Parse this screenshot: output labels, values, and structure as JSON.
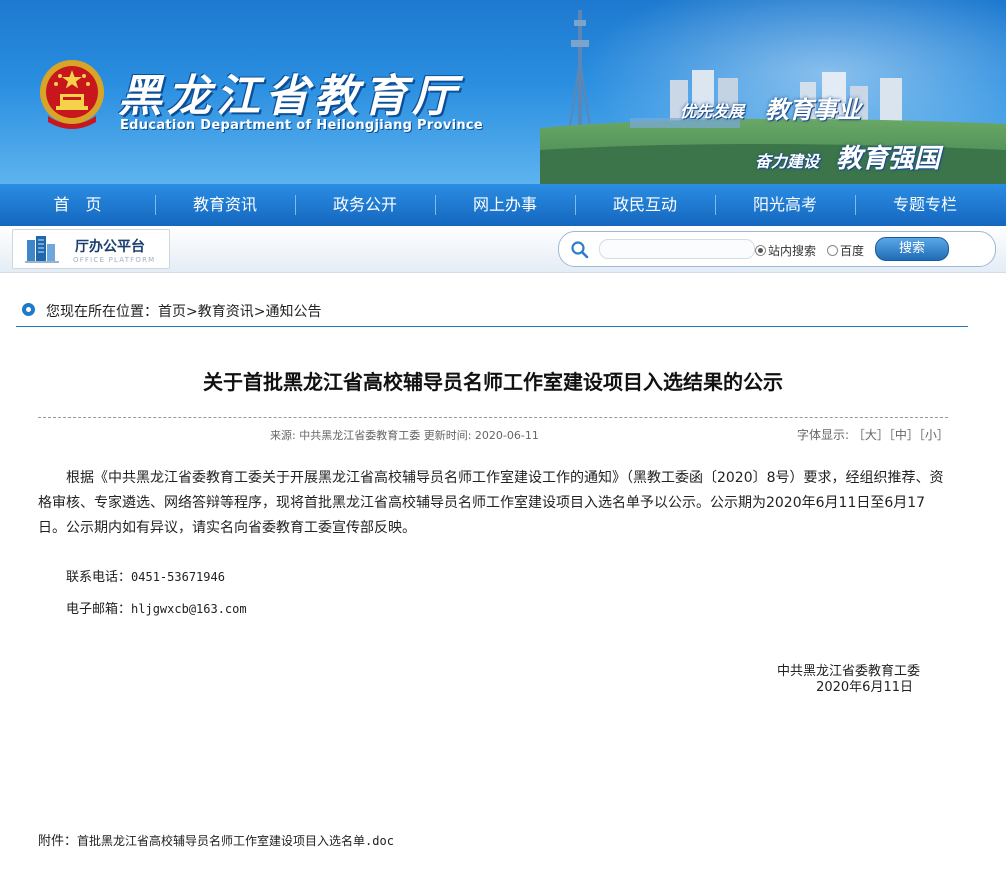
{
  "header": {
    "title": "黑龙江省教育厅",
    "subtitle": "Education Department of Heilongjiang Province",
    "slogans": [
      "优先发展",
      "教育事业",
      "奋力建设",
      "教育强国"
    ]
  },
  "nav": [
    "首　页",
    "教育资讯",
    "政务公开",
    "网上办事",
    "政民互动",
    "阳光高考",
    "专题专栏"
  ],
  "toolbar": {
    "office_label": "厅办公平台",
    "office_sub": "OFFICE PLATFORM",
    "search_placeholder": "",
    "radio_site": "站内搜索",
    "radio_baidu": "百度",
    "search_button": "搜索"
  },
  "breadcrumb": "您现在所在位置：首页>教育资讯>通知公告",
  "article": {
    "title": "关于首批黑龙江省高校辅导员名师工作室建设项目入选结果的公示",
    "meta": "来源: 中共黑龙江省委教育工委 更新时间: 2020-06-11",
    "font_label": "字体显示:",
    "font_large": "［大］",
    "font_medium": "［中］",
    "font_small": "［小］",
    "body": "根据《中共黑龙江省委教育工委关于开展黑龙江省高校辅导员名师工作室建设工作的通知》（黑教工委函〔2020〕8号）要求，经组织推荐、资格审核、专家遴选、网络答辩等程序，现将首批黑龙江省高校辅导员名师工作室建设项目入选名单予以公示。公示期为2020年6月11日至6月17日。公示期内如有异议，请实名向省委教育工委宣传部反映。",
    "phone_label": "联系电话：",
    "phone": "0451-53671946",
    "email_label": "电子邮箱：",
    "email": "hljgwxcb@163.com",
    "signer": "中共黑龙江省委教育工委",
    "sign_date": "2020年6月11日",
    "attach_label": "附件：",
    "attach_file": "首批黑龙江省高校辅导员名师工作室建设项目入选名单.doc"
  },
  "colors": {
    "brand_blue": "#1f7ac8",
    "nav_blue": "#1567be",
    "accent_red": "#c8161d"
  }
}
